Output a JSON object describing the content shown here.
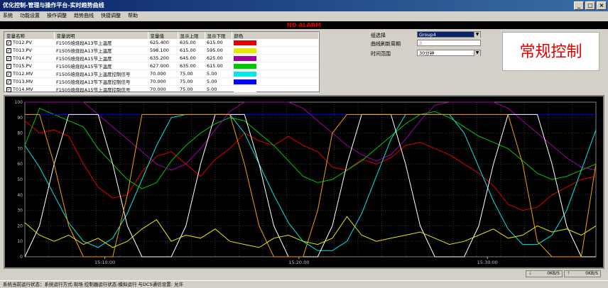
{
  "window": {
    "title": "优化控制-管理与操作平台-实时趋势曲线"
  },
  "menu": [
    "系统",
    "功能设置",
    "操作调整",
    "趋势曲线",
    "快捷调整",
    "帮助"
  ],
  "alarm": {
    "text": "NO ALARM"
  },
  "table": {
    "headers": [
      "变量名称",
      "变量说明",
      "变量值",
      "显示上限",
      "显示下限",
      "颜色"
    ],
    "rows": [
      {
        "name": "T012.PV",
        "desc": "F1505焙烧段A13节上温度",
        "value": "625.400",
        "upper": "635.00",
        "lower": "615.00",
        "color": "#e00000"
      },
      {
        "name": "T013.PV",
        "desc": "F1505焙烧段A13节上温度",
        "value": "598.100",
        "upper": "615.00",
        "lower": "595.00",
        "color": "#e8e800"
      },
      {
        "name": "T014.PV",
        "desc": "F1505焙烧段A15节上温度",
        "value": "635.200",
        "upper": "645.00",
        "lower": "625.00",
        "color": "#a000a0"
      },
      {
        "name": "T015.PV",
        "desc": "F1505焙烧段A15节下温度",
        "value": "627.000",
        "upper": "635.00",
        "lower": "615.00",
        "color": "#00c800"
      },
      {
        "name": "T012.MV",
        "desc": "F1505焙烧段A13节上温度控制信号",
        "value": "70.000",
        "upper": "75.00",
        "lower": "5.00",
        "color": "#00e8e8"
      },
      {
        "name": "T013.MV",
        "desc": "F1505焙烧段A13节下温度控制信号",
        "value": "70.000",
        "upper": "75.00",
        "lower": "5.00",
        "color": "#0000ff"
      },
      {
        "name": "T014.MV",
        "desc": "F1505焙烧段A15节上温度控制信号",
        "value": "70.000",
        "upper": "75.00",
        "lower": "5.00",
        "color": "#ffffff"
      },
      {
        "name": "T015.MV",
        "desc": "F1505焙烧段A15节下温度控制信号",
        "value": "70.000",
        "upper": "75.00",
        "lower": "5.00",
        "color": "#f0a000"
      }
    ]
  },
  "controls": {
    "group_label": "组选择",
    "group_value": "Group4",
    "refresh_label": "曲线刷新周期",
    "refresh_value": "3",
    "range_label": "时间范围",
    "range_value": "30分钟"
  },
  "mode_label": "常规控制",
  "chart_data": {
    "type": "line",
    "ylim": [
      0,
      100
    ],
    "yticks": [
      0,
      10,
      20,
      30,
      40,
      50,
      60,
      70,
      80,
      90,
      100
    ],
    "xticks": [
      "15:10:00",
      "15:20:00",
      "15:30:00"
    ],
    "grid": true,
    "series": [
      {
        "color": "#e00000",
        "values": [
          88,
          80,
          82,
          78,
          60,
          45,
          38,
          40,
          55,
          65,
          68,
          60,
          52,
          63,
          70,
          80,
          75,
          72,
          78,
          72,
          68,
          58,
          56,
          63,
          60,
          64,
          72,
          74,
          70,
          66,
          60,
          54,
          46,
          34,
          30,
          32,
          40,
          45,
          50,
          52
        ]
      },
      {
        "color": "#00c800",
        "values": [
          72,
          96,
          92,
          88,
          84,
          70,
          60,
          50,
          44,
          48,
          62,
          72,
          80,
          86,
          90,
          88,
          80,
          72,
          62,
          52,
          48,
          50,
          56,
          62,
          70,
          78,
          86,
          92,
          94,
          90,
          84,
          78,
          74,
          70,
          62,
          54,
          50,
          52,
          56,
          60
        ]
      },
      {
        "color": "#a000a0",
        "values": [
          100,
          100,
          100,
          100,
          100,
          92,
          84,
          76,
          68,
          60,
          56,
          60,
          70,
          82,
          94,
          100,
          100,
          100,
          100,
          96,
          88,
          80,
          72,
          66,
          62,
          66,
          76,
          88,
          98,
          100,
          100,
          100,
          100,
          96,
          88,
          80,
          72,
          64,
          58,
          56
        ]
      },
      {
        "color": "#00e8e8",
        "values": [
          72,
          58,
          40,
          22,
          10,
          6,
          12,
          28,
          50,
          72,
          90,
          92,
          92,
          92,
          92,
          80,
          60,
          40,
          22,
          10,
          4,
          4,
          10,
          28,
          52,
          76,
          92,
          92,
          92,
          92,
          80,
          58,
          36,
          18,
          8,
          8,
          14,
          30,
          56,
          82
        ]
      },
      {
        "color": "#0000ff",
        "values": [
          92,
          92,
          92,
          92,
          92,
          92,
          92,
          92,
          92,
          92,
          92,
          92,
          92,
          92,
          92,
          92,
          92,
          92,
          92,
          92,
          92,
          92,
          92,
          92,
          92,
          92,
          92,
          92,
          92,
          92,
          92,
          92,
          92,
          92,
          92,
          92,
          92,
          92,
          92,
          92
        ]
      },
      {
        "color": "#ffffff",
        "values": [
          0,
          20,
          60,
          92,
          92,
          92,
          60,
          20,
          0,
          0,
          0,
          20,
          60,
          92,
          92,
          92,
          60,
          20,
          0,
          0,
          0,
          20,
          60,
          92,
          92,
          92,
          60,
          20,
          0,
          0,
          0,
          20,
          60,
          92,
          92,
          92,
          60,
          20,
          0,
          0
        ]
      },
      {
        "color": "#f0a000",
        "values": [
          92,
          92,
          60,
          20,
          0,
          0,
          0,
          40,
          92,
          92,
          92,
          92,
          92,
          92,
          92,
          60,
          20,
          0,
          0,
          0,
          30,
          80,
          92,
          92,
          92,
          92,
          92,
          92,
          92,
          92,
          92,
          92,
          92,
          92,
          60,
          10,
          0,
          0,
          0,
          60
        ]
      },
      {
        "color": "#e8e800",
        "values": [
          22,
          14,
          10,
          14,
          8,
          12,
          6,
          10,
          18,
          24,
          10,
          14,
          12,
          18,
          10,
          8,
          6,
          12,
          14,
          10,
          8,
          12,
          26,
          14,
          10,
          12,
          14,
          16,
          12,
          8,
          10,
          14,
          18,
          12,
          14,
          20,
          16,
          18,
          14,
          20
        ]
      }
    ]
  },
  "status": {
    "bottom_text": "系统当前运行状态：系统运行方式:现场 控制器运行状态:模拟运行 与DCS通信设置: 允许",
    "rate1": "0KB/S",
    "rate2": "0KB/S"
  }
}
